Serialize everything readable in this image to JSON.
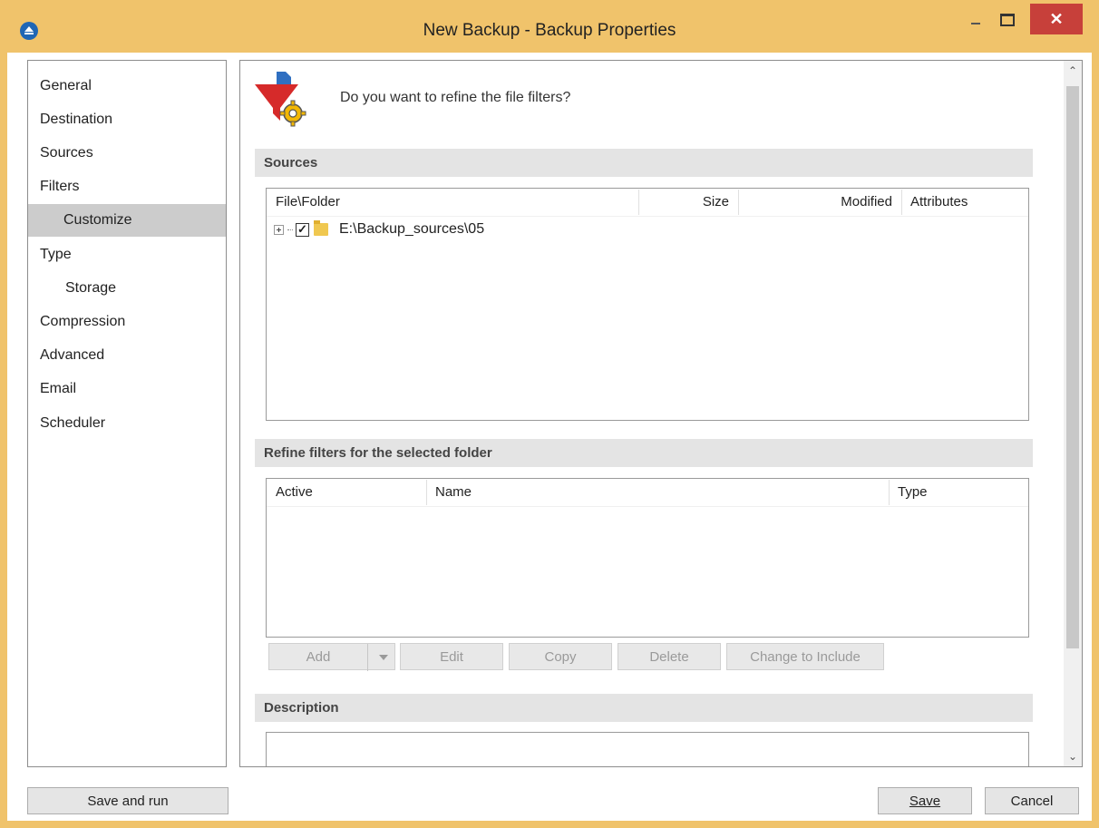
{
  "window": {
    "title": "New Backup - Backup Properties",
    "close_glyph": "✕",
    "accent_color": "#f0c36b",
    "close_color": "#c7403a"
  },
  "nav": {
    "items": [
      {
        "label": "General"
      },
      {
        "label": "Destination"
      },
      {
        "label": "Sources"
      },
      {
        "label": "Filters"
      },
      {
        "label": "Customize",
        "selected": true
      },
      {
        "label": "Type"
      },
      {
        "label": "Storage"
      },
      {
        "label": "Compression"
      },
      {
        "label": "Advanced"
      },
      {
        "label": "Email"
      },
      {
        "label": "Scheduler"
      }
    ]
  },
  "header": {
    "icon": "filter-gear-icon",
    "question": "Do you want to refine the file filters?"
  },
  "sources": {
    "title": "Sources",
    "columns": [
      "File\\Folder",
      "Size",
      "Modified",
      "Attributes"
    ],
    "rows": [
      {
        "checked": true,
        "check_glyph": "✓",
        "name": "E:\\Backup_sources\\05"
      }
    ]
  },
  "refine": {
    "title": "Refine filters for the selected folder",
    "columns": [
      "Active",
      "Name",
      "Type"
    ],
    "buttons": {
      "add": "Add",
      "edit": "Edit",
      "copy": "Copy",
      "delete": "Delete",
      "change": "Change to Include"
    }
  },
  "description": {
    "title": "Description",
    "value": ""
  },
  "scrollbar": {
    "up_glyph": "⌃",
    "down_glyph": "⌄"
  },
  "footer": {
    "save_and_run": "Save and run",
    "save": "Save",
    "cancel": "Cancel"
  }
}
